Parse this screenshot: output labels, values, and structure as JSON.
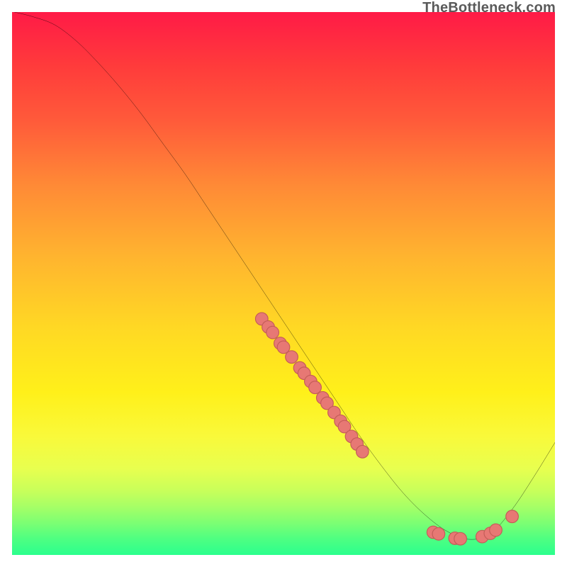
{
  "watermark": "TheBottleneck.com",
  "colors": {
    "gradient_top": "#ff1a47",
    "gradient_mid": "#ffd824",
    "gradient_bottom": "#2aff8e",
    "curve": "#000000",
    "marker": "#e77874",
    "marker_stroke": "#c45c58"
  },
  "chart_data": {
    "type": "line",
    "title": "",
    "xlabel": "",
    "ylabel": "",
    "xlim": [
      0,
      100
    ],
    "ylim": [
      0,
      100
    ],
    "grid": false,
    "legend": false,
    "series": [
      {
        "name": "bottleneck-curve",
        "x": [
          0,
          4,
          8,
          12,
          16,
          20,
          24,
          28,
          32,
          36,
          40,
          44,
          48,
          52,
          56,
          60,
          64,
          68,
          72,
          76,
          80,
          84,
          88,
          92,
          96,
          100
        ],
        "y": [
          100,
          99,
          97.5,
          94.5,
          90.5,
          86,
          81,
          75.5,
          70,
          64,
          58,
          52,
          46,
          40,
          34,
          28,
          22,
          16.5,
          11.5,
          7.5,
          4.5,
          3,
          4,
          8.5,
          14.5,
          21
        ]
      }
    ],
    "markers": [
      {
        "series": "cluster-descent",
        "points": [
          {
            "x": 46,
            "y": 43.5
          },
          {
            "x": 47.2,
            "y": 42
          },
          {
            "x": 48,
            "y": 41
          },
          {
            "x": 49.4,
            "y": 39
          },
          {
            "x": 50,
            "y": 38.3
          },
          {
            "x": 51.5,
            "y": 36.5
          },
          {
            "x": 53,
            "y": 34.5
          },
          {
            "x": 53.8,
            "y": 33.5
          },
          {
            "x": 55,
            "y": 32
          },
          {
            "x": 55.8,
            "y": 30.9
          },
          {
            "x": 57.2,
            "y": 29
          },
          {
            "x": 58,
            "y": 28
          },
          {
            "x": 59.3,
            "y": 26.3
          },
          {
            "x": 60.5,
            "y": 24.7
          },
          {
            "x": 61.2,
            "y": 23.7
          },
          {
            "x": 62.5,
            "y": 21.9
          },
          {
            "x": 63.5,
            "y": 20.5
          },
          {
            "x": 64.5,
            "y": 19.1
          }
        ]
      },
      {
        "series": "cluster-valley",
        "points": [
          {
            "x": 77.5,
            "y": 4.3
          },
          {
            "x": 78.5,
            "y": 4.0
          },
          {
            "x": 81.5,
            "y": 3.2
          },
          {
            "x": 82.5,
            "y": 3.1
          },
          {
            "x": 86.5,
            "y": 3.5
          },
          {
            "x": 88,
            "y": 4.1
          },
          {
            "x": 89,
            "y": 4.7
          },
          {
            "x": 92,
            "y": 7.2
          }
        ]
      }
    ]
  }
}
